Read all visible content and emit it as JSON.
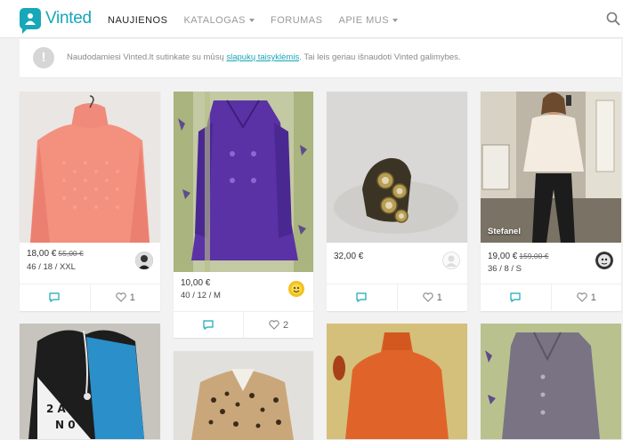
{
  "header": {
    "logo_text": "Vinted",
    "nav": [
      {
        "label": "NAUJIENOS",
        "active": true,
        "dropdown": false
      },
      {
        "label": "KATALOGAS",
        "active": false,
        "dropdown": true
      },
      {
        "label": "FORUMAS",
        "active": false,
        "dropdown": false
      },
      {
        "label": "APIE MUS",
        "active": false,
        "dropdown": true
      }
    ],
    "search_icon": "search-icon"
  },
  "notice": {
    "icon": "!",
    "text_before": "Naudodamiesi Vinted.lt sutinkate su mūsų ",
    "link": "slapukų taisyklėmis",
    "text_after": ". Tai leis geriau išnaudoti Vinted galimybes."
  },
  "items": [
    {
      "price": "18,00 €",
      "old_price": "55,00 €",
      "meta": "46 / 18 / XXL",
      "likes": "1",
      "brand": ""
    },
    {
      "price": "10,00 €",
      "old_price": "",
      "meta": "40 / 12 / M",
      "likes": "2",
      "brand": ""
    },
    {
      "price": "32,00 €",
      "old_price": "",
      "meta": "",
      "likes": "1",
      "brand": ""
    },
    {
      "price": "19,00 €",
      "old_price": "159,00 €",
      "meta": "36 / 8 / S",
      "likes": "1",
      "brand": "Stefanel"
    }
  ],
  "colors": {
    "brand": "#17a7b8",
    "background": "#f2f2f2"
  }
}
